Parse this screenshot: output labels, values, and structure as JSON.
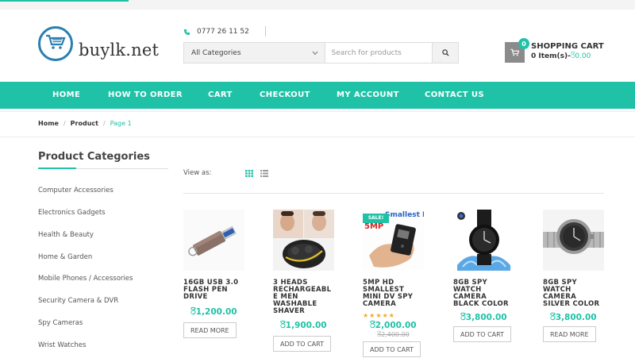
{
  "site": {
    "logo_text": "buylk.net",
    "phone": "0777 26 11 52"
  },
  "search": {
    "category_selected": "All Categories",
    "placeholder": "Search for products"
  },
  "cart": {
    "title": "SHOPPING CART",
    "items_label": "0 Item(s)-",
    "amount": "රි0.00",
    "count": "0"
  },
  "nav": {
    "items": [
      "HOME",
      "HOW TO ORDER",
      "CART",
      "CHECKOUT",
      "MY ACCOUNT",
      "CONTACT US"
    ]
  },
  "breadcrumb": {
    "items": [
      "Home",
      "Product",
      "Page 1"
    ]
  },
  "sidebar": {
    "title": "Product Categories",
    "items": [
      "Computer Accessories",
      "Electronics Gadgets",
      "Health & Beauty",
      "Home & Garden",
      "Mobile Phones / Accessories",
      "Security Camera & DVR",
      "Spy Cameras",
      "Wrist Watches"
    ]
  },
  "toolbar": {
    "view_as": "View as:"
  },
  "products": [
    {
      "name_lines": [
        "16GB USB 3.0",
        "FLASH PEN",
        "DRIVE"
      ],
      "price": "රි1,200.00",
      "button": "READ MORE"
    },
    {
      "name_lines": [
        "3 HEADS",
        "RECHARGEABL",
        "E MEN",
        "WASHABLE",
        "SHAVER"
      ],
      "price": "රි1,900.00",
      "button": "ADD TO CART"
    },
    {
      "name_lines": [
        "5MP HD",
        "SMALLEST",
        "MINI DV SPY",
        "CAMERA"
      ],
      "sale": "SALE!",
      "rating": 5,
      "price": "රි2,000.00",
      "old_price": "රි2,400.00",
      "button": "ADD TO CART",
      "image_text": [
        "Smallest DV",
        "5MP"
      ]
    },
    {
      "name_lines": [
        "8GB SPY",
        "WATCH",
        "CAMERA",
        "BLACK COLOR"
      ],
      "price": "රි3,800.00",
      "button": "ADD TO CART"
    },
    {
      "name_lines": [
        "8GB SPY",
        "WATCH",
        "CAMERA",
        "SILVER COLOR"
      ],
      "price": "රි3,800.00",
      "button": "READ MORE"
    }
  ],
  "colors": {
    "accent": "#1fc2a7",
    "nav_bg": "#1fc2a7",
    "logo_blue": "#2a7fb0"
  }
}
